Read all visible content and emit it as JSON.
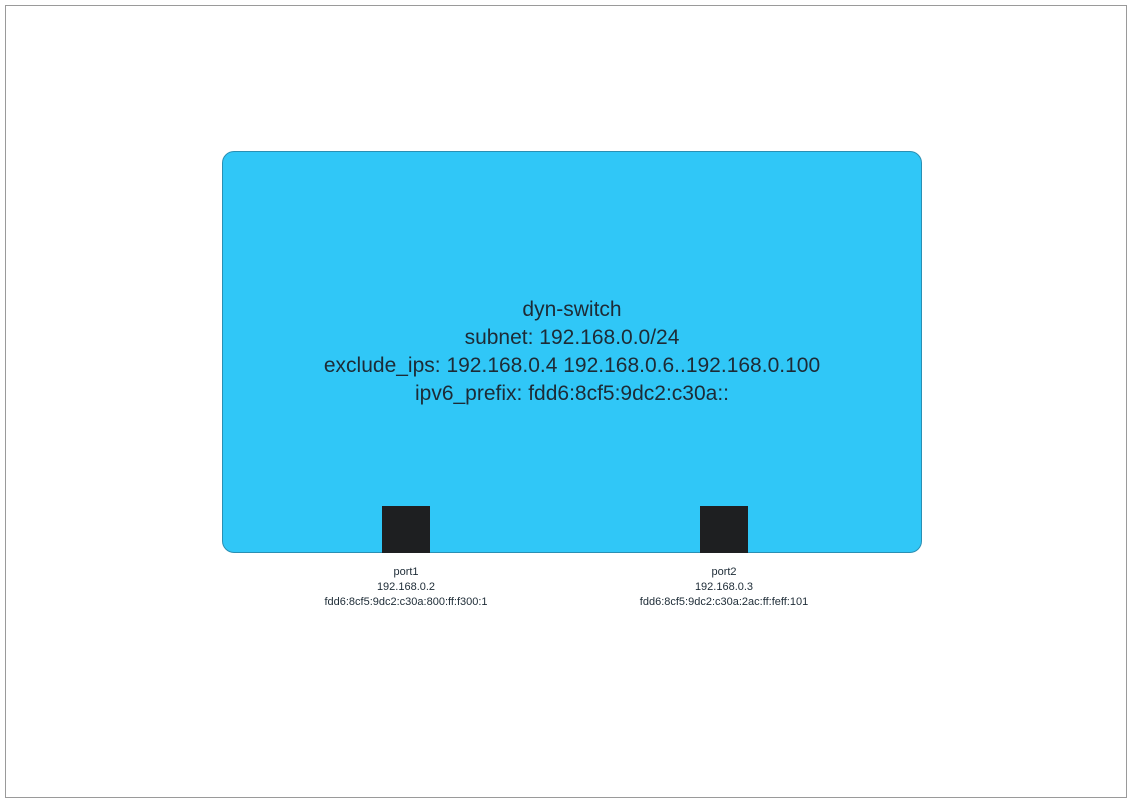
{
  "switch": {
    "name": "dyn-switch",
    "subnet": "subnet: 192.168.0.0/24",
    "exclude_ips": "exclude_ips: 192.168.0.4 192.168.0.6..192.168.0.100",
    "ipv6_prefix": "ipv6_prefix: fdd6:8cf5:9dc2:c30a::",
    "color": "#30c7f7"
  },
  "ports": [
    {
      "name": "port1",
      "ipv4": "192.168.0.2",
      "ipv6": "fdd6:8cf5:9dc2:c30a:800:ff:f300:1"
    },
    {
      "name": "port2",
      "ipv4": "192.168.0.3",
      "ipv6": "fdd6:8cf5:9dc2:c30a:2ac:ff:feff:101"
    }
  ]
}
